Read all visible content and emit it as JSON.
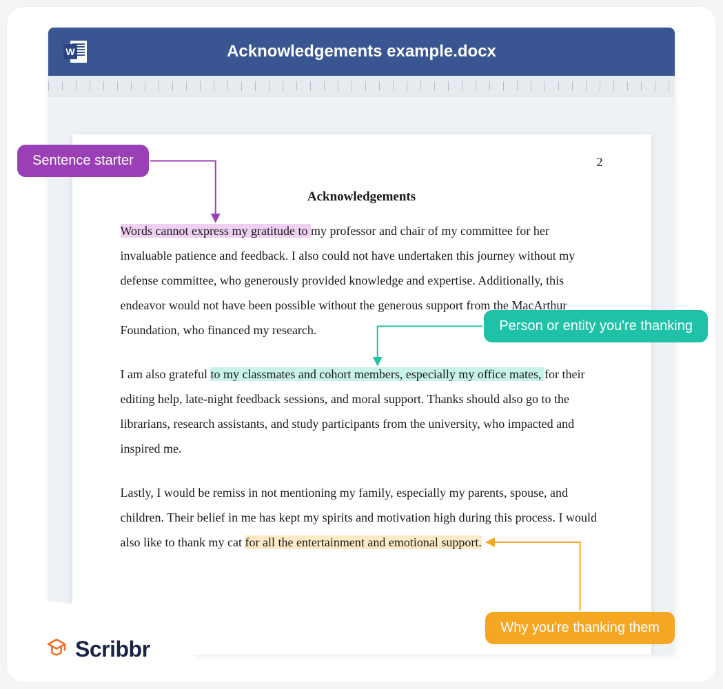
{
  "titlebar": {
    "filename": "Acknowledgements example.docx"
  },
  "page": {
    "number": "2",
    "heading": "Acknowledgements",
    "p1_before_hl": "",
    "p1_hl_purple": "Words cannot express my gratitude to ",
    "p1_after_hl": "my professor and chair of my committee for her invaluable patience and feedback. I also could not have undertaken this journey without my defense committee, who generously provided knowledge and expertise. Additionally, this endeavor would not have been possible without the generous support from the MacArthur Foundation, who financed my research.",
    "p2_before_hl": "I am also grateful ",
    "p2_hl_teal": "to my classmates and cohort members, especially my office mates, ",
    "p2_after_hl": "for their editing help, late-night feedback sessions, and moral support. Thanks should also go to the librarians, research assistants, and study participants from the university, who impacted and inspired me.",
    "p3_before_hl": "Lastly, I would be remiss in not mentioning my family, especially my parents, spouse, and children. Their belief in me has kept my spirits and motivation high during this process. I would also like to thank my cat ",
    "p3_hl_orange": "for all the entertainment and emotional support.",
    "p3_after_hl": ""
  },
  "callouts": {
    "purple": "Sentence starter",
    "teal": "Person or entity you're thanking",
    "orange": "Why you're thanking them"
  },
  "logo": {
    "brand": "Scribbr"
  }
}
